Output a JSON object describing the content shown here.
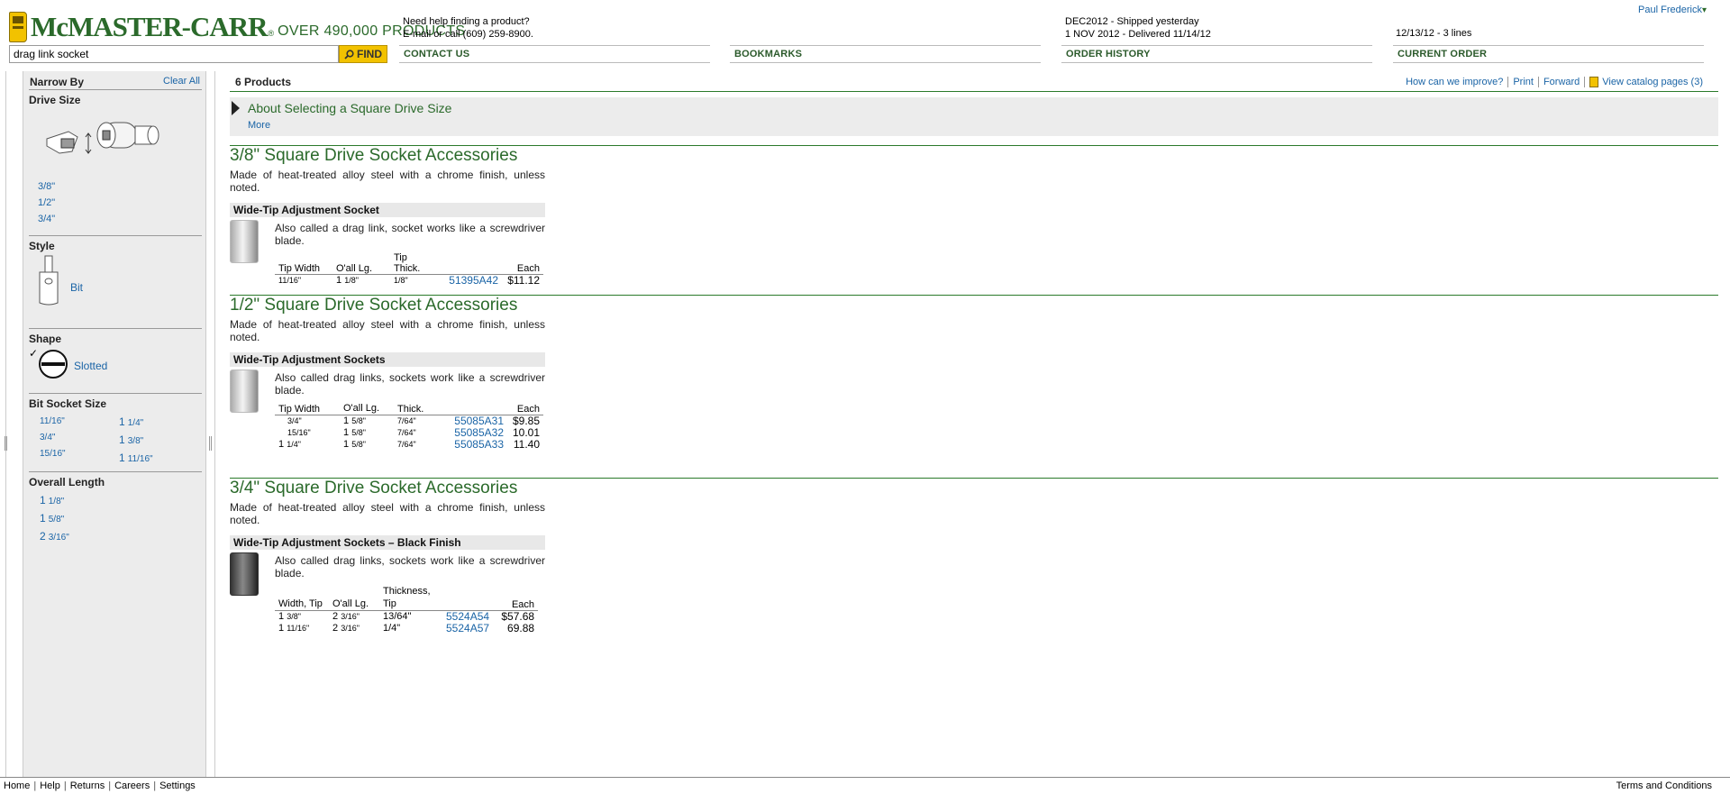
{
  "header": {
    "brand": "McMASTER-CARR",
    "reg": "®",
    "tagline": "OVER 490,000 PRODUCTS",
    "search_value": "drag link socket",
    "find_label": "FIND",
    "help_line1": "Need help finding a product?",
    "help_line2": "E-mail or call (609) 259-8900.",
    "contact_label": "CONTACT US",
    "bookmarks_label": "BOOKMARKS",
    "order_line1": "DEC2012 - Shipped yesterday",
    "order_line2": "1 NOV 2012 - Delivered 11/14/12",
    "order_history_label": "ORDER HISTORY",
    "current_order_info": "12/13/12 - 3 lines",
    "current_order_label": "CURRENT ORDER",
    "user": "Paul Frederick",
    "user_arrow": "▾"
  },
  "sidebar": {
    "title": "Narrow By",
    "clear_all": "Clear All",
    "drive_size": {
      "title": "Drive Size",
      "options": [
        "3/8\"",
        "1/2\"",
        "3/4\""
      ]
    },
    "style": {
      "title": "Style",
      "option": "Bit"
    },
    "shape": {
      "title": "Shape",
      "check": "✓",
      "option": "Slotted"
    },
    "bit_socket_size": {
      "title": "Bit Socket Size",
      "col1": [
        "11/16\"",
        "3/4\"",
        "15/16\""
      ],
      "col2": [
        {
          "whole": "1",
          "frac": "1/4\""
        },
        {
          "whole": "1",
          "frac": "3/8\""
        },
        {
          "whole": "1",
          "frac": "11/16\""
        }
      ]
    },
    "overall_length": {
      "title": "Overall Length",
      "options": [
        {
          "whole": "1",
          "frac": "1/8\""
        },
        {
          "whole": "1",
          "frac": "5/8\""
        },
        {
          "whole": "2",
          "frac": "3/16\""
        }
      ]
    }
  },
  "main": {
    "count": "6 Products",
    "toolbar": {
      "improve": "How can we improve?",
      "print": "Print",
      "forward": "Forward",
      "catalog": "View catalog pages (3)"
    },
    "about": {
      "title": "About Selecting a Square Drive Size",
      "more": "More"
    },
    "sections": [
      {
        "title": "3/8\" Square Drive Socket Accessories",
        "desc": "Made of heat-treated alloy steel with a chrome finish, unless noted.",
        "sub": "Wide-Tip Adjustment Socket",
        "note": "Also called a drag link, socket works like a screwdriver blade.",
        "headers": [
          "Tip Width",
          "O'all Lg.",
          "Tip Thick.",
          "",
          "Each"
        ],
        "rows": [
          {
            "c1": "11/16\"",
            "c2w": "1",
            "c2f": "1/8\"",
            "c3": "1/8\"",
            "part": "51395A42",
            "price": "$11.12"
          }
        ]
      },
      {
        "title": "1/2\" Square Drive Socket Accessories",
        "desc": "Made of heat-treated alloy steel with a chrome finish, unless noted.",
        "sub": "Wide-Tip Adjustment Sockets",
        "note": "Also called drag links, sockets work like a screwdriver blade.",
        "headers": [
          "Tip Width",
          "O'all Lg.",
          "Thick.",
          "",
          "Each"
        ],
        "rows": [
          {
            "c1": "3/4\"",
            "c2w": "1",
            "c2f": "5/8\"",
            "c3": "7/64\"",
            "part": "55085A31",
            "price": "$9.85"
          },
          {
            "c1": "15/16\"",
            "c2w": "1",
            "c2f": "5/8\"",
            "c3": "7/64\"",
            "part": "55085A32",
            "price": "10.01"
          },
          {
            "c1w": "1",
            "c1": "1/4\"",
            "c2w": "1",
            "c2f": "5/8\"",
            "c3": "7/64\"",
            "part": "55085A33",
            "price": "11.40"
          }
        ]
      },
      {
        "title": "3/4\" Square Drive Socket Accessories",
        "desc": "Made of heat-treated alloy steel with a chrome finish, unless noted.",
        "sub": "Wide-Tip Adjustment Sockets – Black Finish",
        "note": "Also called drag links, sockets work like a screwdriver blade.",
        "headers": [
          "Width, Tip",
          "O'all Lg.",
          "Thickness, Tip",
          "",
          "Each"
        ],
        "rows": [
          {
            "c1w": "1",
            "c1": "3/8\"",
            "c2w": "2",
            "c2f": "3/16\"",
            "c3": "13/64\"",
            "part": "5524A54",
            "price": "$57.68"
          },
          {
            "c1w": "1",
            "c1": "11/16\"",
            "c2w": "2",
            "c2f": "3/16\"",
            "c3": "1/4\"",
            "part": "5524A57",
            "price": "69.88"
          }
        ]
      }
    ]
  },
  "footer": {
    "links": [
      "Home",
      "Help",
      "Returns",
      "Careers",
      "Settings"
    ],
    "terms": "Terms and Conditions"
  }
}
